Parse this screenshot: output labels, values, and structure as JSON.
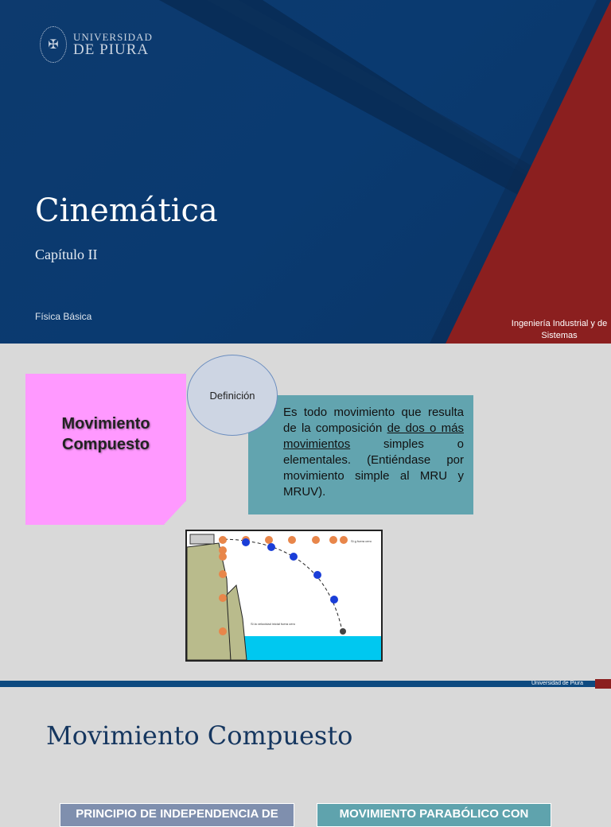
{
  "slide1": {
    "logo_line1": "UNIVERSIDAD",
    "logo_line2": "DE PIURA",
    "title": "Cinemática",
    "subtitle": "Capítulo II",
    "course": "Física Básica",
    "department": "Ingeniería Industrial y de Sistemas"
  },
  "slide2": {
    "note": "Movimiento Compuesto",
    "definition_label": "Definición",
    "definition_pre": "Es todo movimiento que resulta de la composición ",
    "definition_underlined": "de dos o más movimientos",
    "definition_post": " simples o elementales. (Entiéndase por movimiento simple al MRU y MRUV).",
    "figure_label_top": "Si g fuera cero",
    "figure_label_mid": "Si la velocidad inicial fuera cero",
    "footer": "Universidad de Piura"
  },
  "slide3": {
    "title": "Movimiento Compuesto",
    "button1": "PRINCIPIO DE INDEPENDENCIA DE",
    "button2": "MOVIMIENTO PARABÓLICO CON"
  },
  "colors": {
    "navy": "#0d3a6e",
    "red": "#8b1f1f",
    "teal": "#62a4af",
    "pink": "#ff99ff"
  }
}
